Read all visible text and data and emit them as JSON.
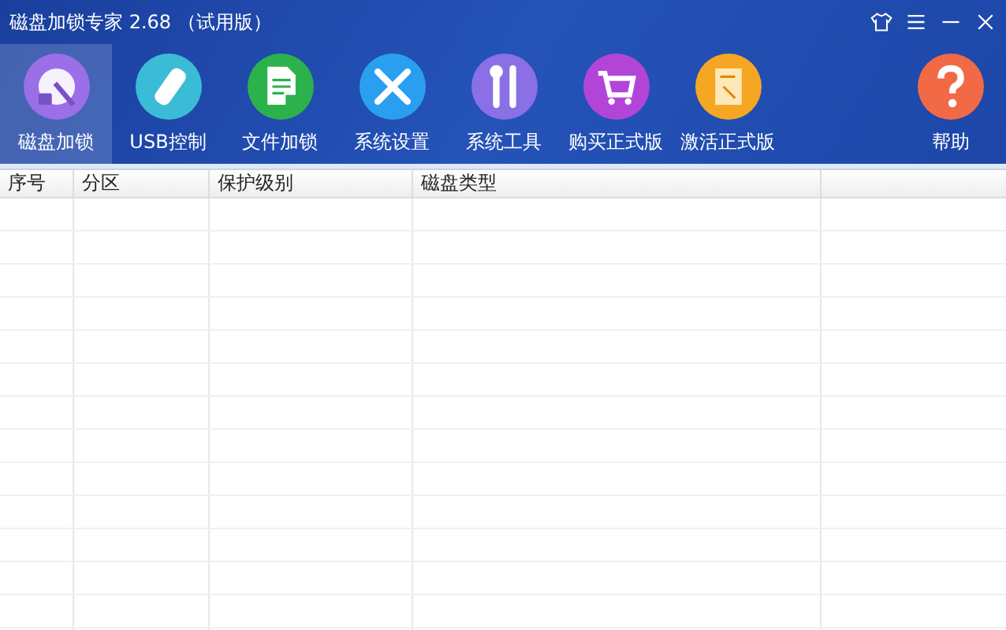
{
  "window": {
    "title": "磁盘加锁专家 2.68 （试用版）"
  },
  "toolbar": [
    {
      "label": "磁盘加锁",
      "selected": true
    },
    {
      "label": "USB控制",
      "selected": false
    },
    {
      "label": "文件加锁",
      "selected": false
    },
    {
      "label": "系统设置",
      "selected": false
    },
    {
      "label": "系统工具",
      "selected": false
    },
    {
      "label": "购买正式版",
      "selected": false
    },
    {
      "label": "激活正式版",
      "selected": false
    },
    {
      "label": "帮助",
      "selected": false
    }
  ],
  "table": {
    "columns": [
      "序号",
      "分区",
      "保护级别",
      "磁盘类型"
    ]
  }
}
